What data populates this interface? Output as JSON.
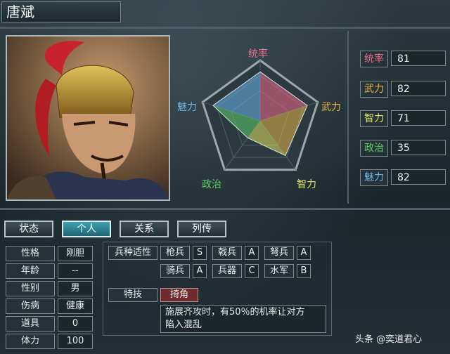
{
  "officer_name": "唐斌",
  "radar": {
    "labels": {
      "lead": "统率",
      "war": "武力",
      "int": "智力",
      "pol": "政治",
      "cha": "魅力"
    },
    "values": {
      "lead": 81,
      "war": 82,
      "int": 71,
      "pol": 35,
      "cha": 82
    },
    "colors": {
      "lead": "#f06a8a",
      "war": "#e7b64a",
      "int": "#e0e060",
      "pol": "#5fd06a",
      "cha": "#6ab4ea"
    }
  },
  "stats": [
    {
      "label": "统率",
      "value": "81",
      "color": "#f06a8a"
    },
    {
      "label": "武力",
      "value": "82",
      "color": "#e7b64a"
    },
    {
      "label": "智力",
      "value": "71",
      "color": "#e0e060"
    },
    {
      "label": "政治",
      "value": "35",
      "color": "#5fd06a"
    },
    {
      "label": "魅力",
      "value": "82",
      "color": "#6ab4ea"
    }
  ],
  "tabs": [
    "状态",
    "个人",
    "关系",
    "列传"
  ],
  "personal": [
    {
      "label": "性格",
      "value": "刚胆"
    },
    {
      "label": "年龄",
      "value": "--"
    },
    {
      "label": "性别",
      "value": "男"
    },
    {
      "label": "伤病",
      "value": "健康"
    },
    {
      "label": "道具",
      "value": "0"
    },
    {
      "label": "体力",
      "value": "100"
    }
  ],
  "aptitude": {
    "header": "兵种适性",
    "items": [
      {
        "label": "枪兵",
        "grade": "S"
      },
      {
        "label": "戟兵",
        "grade": "A"
      },
      {
        "label": "弩兵",
        "grade": "A"
      },
      {
        "label": "骑兵",
        "grade": "A"
      },
      {
        "label": "兵器",
        "grade": "C"
      },
      {
        "label": "水军",
        "grade": "B"
      }
    ]
  },
  "skill": {
    "label": "特技",
    "name": "掎角",
    "desc_line1": "施展齐攻时，有50％的机率让对方",
    "desc_line2": "陷入混乱"
  },
  "watermark": "头条 @奕道君心"
}
